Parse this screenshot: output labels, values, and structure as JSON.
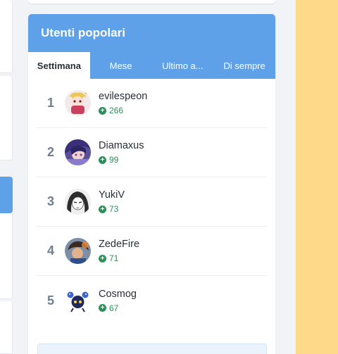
{
  "widget": {
    "title": "Utenti popolari",
    "tabs": [
      {
        "label": "Settimana",
        "active": true
      },
      {
        "label": "Mese",
        "active": false
      },
      {
        "label": "Ultimo a...",
        "active": false
      },
      {
        "label": "Di sempre",
        "active": false
      }
    ],
    "users": [
      {
        "rank": "1",
        "name": "evilespeon",
        "reputation": "266",
        "avatar": "avatar-evilespeon"
      },
      {
        "rank": "2",
        "name": "Diamaxus",
        "reputation": "99",
        "avatar": "avatar-diamaxus"
      },
      {
        "rank": "3",
        "name": "YukiV",
        "reputation": "73",
        "avatar": "avatar-yukiv"
      },
      {
        "rank": "4",
        "name": "ZedeFire",
        "reputation": "71",
        "avatar": "avatar-zedefire"
      },
      {
        "rank": "5",
        "name": "Cosmog",
        "reputation": "67",
        "avatar": "avatar-cosmog"
      }
    ]
  },
  "colors": {
    "header": "#5fa1e8",
    "reputation": "#2e8f5a",
    "rank": "#6e7f93",
    "sidebar_accent": "#ffd98a"
  },
  "icons": {
    "reputation": "plus-circle-icon"
  }
}
